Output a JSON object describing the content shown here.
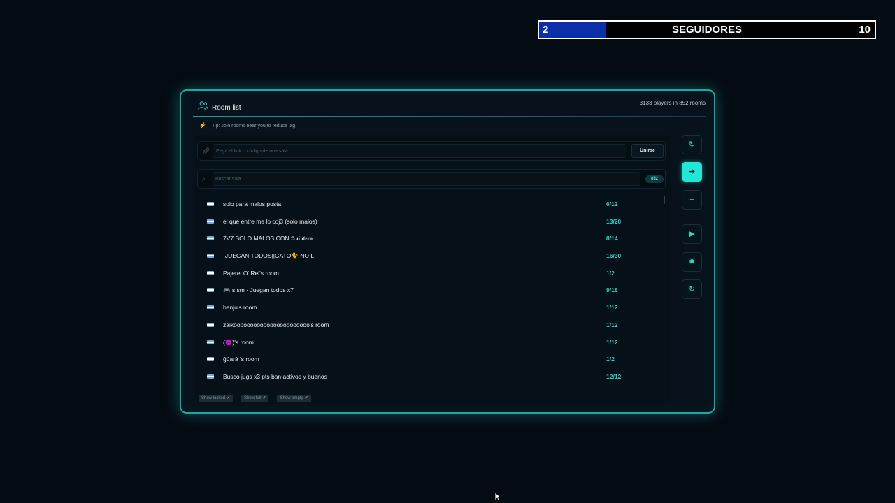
{
  "followers": {
    "current": "2",
    "label": "SEGUIDORES",
    "goal": "10",
    "progress": 0.2,
    "fill_color": "#0b2fa8"
  },
  "panel": {
    "title": "Room list",
    "players_summary": "3133 players in 852 rooms",
    "tip": "Tip: Join rooms near you to reduce lag.",
    "accent_color": "#1ba7a3"
  },
  "join": {
    "placeholder": "Pegá el link o código de una sala...",
    "button_label": "Unirse"
  },
  "search": {
    "placeholder": "Buscar sala...",
    "count_badge": "852"
  },
  "rooms": [
    {
      "name": "solo para malos posta",
      "players": "6/12"
    },
    {
      "name": "el que entre me lo coj3 (solo malos)",
      "players": "13/20"
    },
    {
      "name": "7V7 SOLO MALOS CON 𝕼𝖚𝖎𝖓𝖙𝖊𝖗𝖔",
      "players": "8/14"
    },
    {
      "name": "¡JUEGAN TODOS||GATO🐈 NO L",
      "players": "16/30"
    },
    {
      "name": "Pajerei O' Rei's room",
      "players": "1/2"
    },
    {
      "name": "🎮 s.sm · Juegan todos x7",
      "players": "9/18"
    },
    {
      "name": "benju's room",
      "players": "1/12"
    },
    {
      "name": "zaikoooooooóooooooooooooóoo's room",
      "players": "1/12"
    },
    {
      "name": "(😈)'s room",
      "players": "1/12"
    },
    {
      "name": "ğúará 's room",
      "players": "1/2"
    },
    {
      "name": "Busco jugs x3 pts ban activos y buenos",
      "players": "12/12"
    }
  ],
  "filters": [
    {
      "label": "Show locked",
      "checked": true
    },
    {
      "label": "Show full",
      "checked": true
    },
    {
      "label": "Show empty",
      "checked": true
    }
  ],
  "side_buttons": [
    {
      "name": "refresh-button",
      "icon": "refresh-icon",
      "glyph": "↻"
    },
    {
      "name": "join-room-button",
      "icon": "login-icon",
      "glyph": "➜"
    },
    {
      "name": "create-room-button",
      "icon": "plus-icon",
      "glyph": "+"
    },
    {
      "name": "play-button",
      "icon": "play-icon",
      "glyph": "▶"
    },
    {
      "name": "settings-button",
      "icon": "gear-icon",
      "glyph": "✹"
    },
    {
      "name": "reload-button",
      "icon": "refresh-icon",
      "glyph": "↻"
    }
  ]
}
